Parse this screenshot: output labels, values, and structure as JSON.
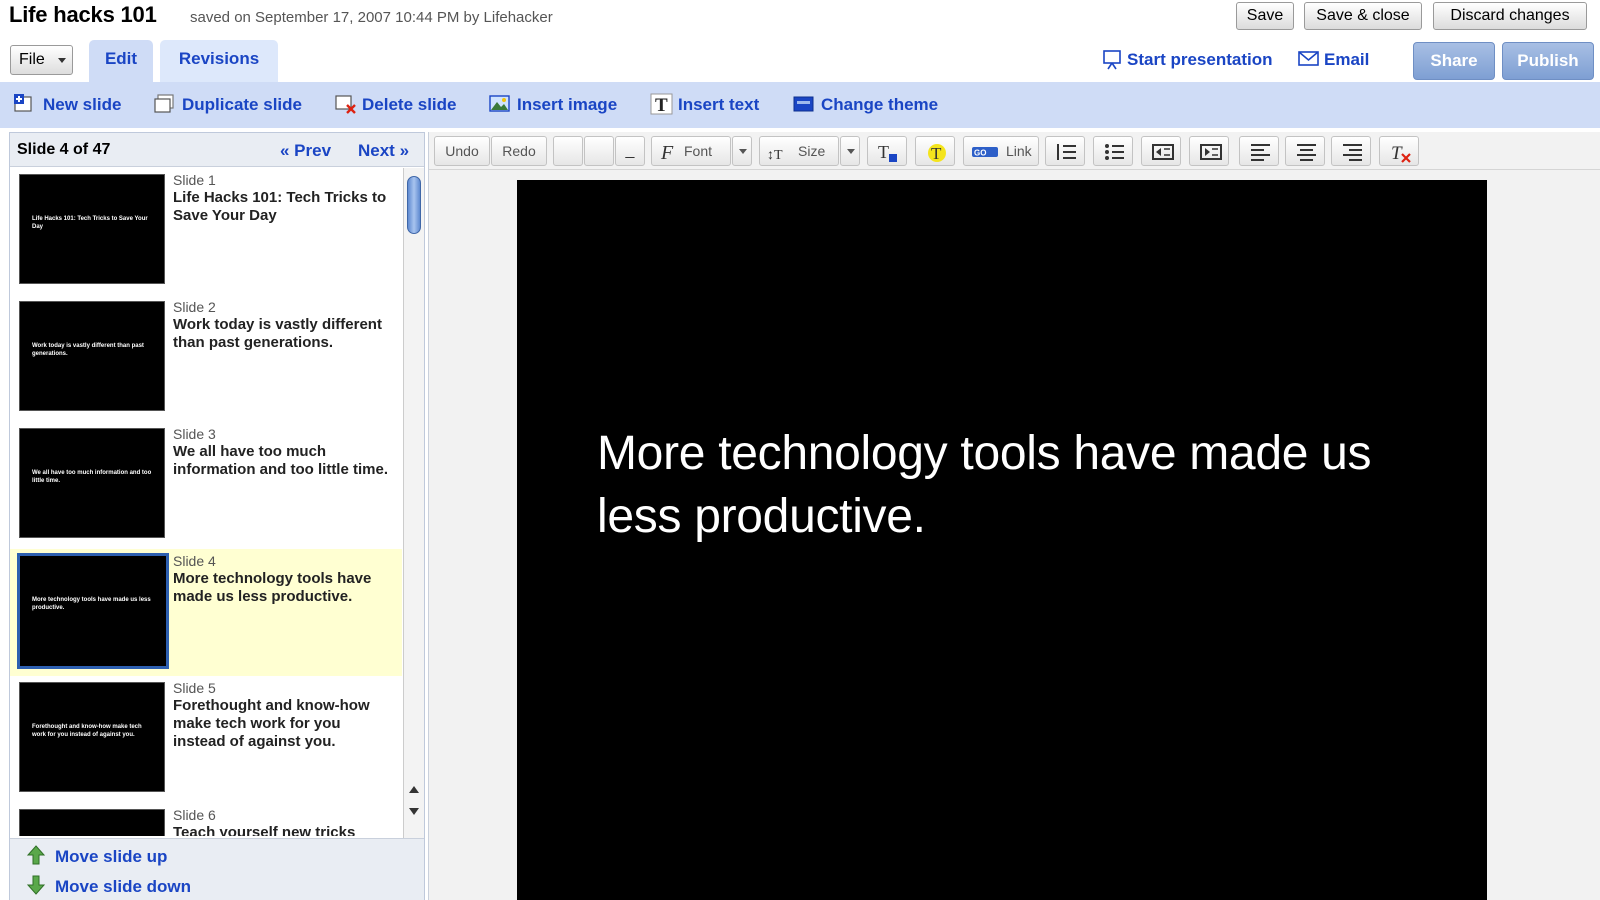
{
  "header": {
    "title": "Life hacks 101",
    "saved_info": "saved on September 17, 2007 10:44 PM by Lifehacker",
    "save_label": "Save",
    "save_close_label": "Save & close",
    "discard_label": "Discard changes"
  },
  "tabs": {
    "file_label": "File",
    "edit_label": "Edit",
    "revisions_label": "Revisions",
    "start_presentation_label": "Start presentation",
    "email_label": "Email",
    "share_label": "Share",
    "publish_label": "Publish"
  },
  "actions": {
    "new_slide": "New slide",
    "duplicate_slide": "Duplicate slide",
    "delete_slide": "Delete slide",
    "insert_image": "Insert image",
    "insert_text": "Insert text",
    "change_theme": "Change theme"
  },
  "slide_panel": {
    "count_label": "Slide 4 of 47",
    "prev_label": "« Prev",
    "next_label": "Next »",
    "slides": [
      {
        "number": "Slide 1",
        "caption": "Life Hacks 101: Tech Tricks to Save Your Day",
        "thumb": "Life Hacks 101: Tech Tricks to Save Your Day"
      },
      {
        "number": "Slide 2",
        "caption": "Work today is vastly different than past generations.",
        "thumb": "Work today is vastly different than past generations."
      },
      {
        "number": "Slide 3",
        "caption": "We all have too much information and too little time.",
        "thumb": "We all have too much information and too little time."
      },
      {
        "number": "Slide 4",
        "caption": "More technology tools have made us less productive.",
        "thumb": "More technology tools have made us less productive."
      },
      {
        "number": "Slide 5",
        "caption": "Forethought and know-how make tech work for you instead of against you.",
        "thumb": "Forethought and know-how make tech work for you instead of against you."
      },
      {
        "number": "Slide 6",
        "caption": "Teach yourself new tricks",
        "thumb": ""
      }
    ],
    "move_up_label": "Move slide up",
    "move_down_label": "Move slide down"
  },
  "toolbar": {
    "undo_label": "Undo",
    "redo_label": "Redo",
    "font_label": "Font",
    "size_label": "Size",
    "link_label": "Link"
  },
  "canvas": {
    "heading": "More technology tools have made us less productive."
  },
  "colors": {
    "link_blue": "#1a45c4",
    "bar_blue": "#cfdcf6",
    "selected_row": "#ffffd2"
  }
}
